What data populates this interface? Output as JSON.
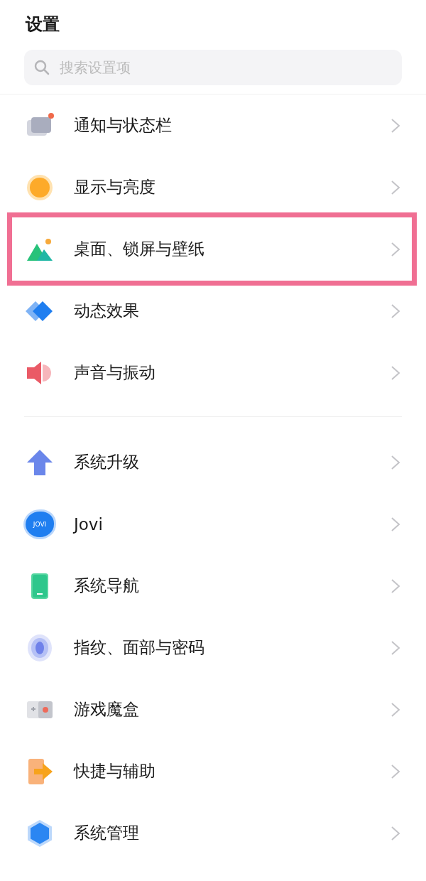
{
  "title": "设置",
  "search": {
    "placeholder": "搜索设置项"
  },
  "groups": [
    {
      "items": [
        {
          "kind": "notification",
          "label": "通知与状态栏",
          "highlighted": false
        },
        {
          "kind": "display",
          "label": "显示与亮度",
          "highlighted": false
        },
        {
          "kind": "wallpaper",
          "label": "桌面、锁屏与壁纸",
          "highlighted": true
        },
        {
          "kind": "motion",
          "label": "动态效果",
          "highlighted": false
        },
        {
          "kind": "sound",
          "label": "声音与振动",
          "highlighted": false
        }
      ]
    },
    {
      "items": [
        {
          "kind": "upgrade",
          "label": "系统升级",
          "highlighted": false
        },
        {
          "kind": "jovi",
          "label": "Jovi",
          "icon_text": "JOVI",
          "highlighted": false
        },
        {
          "kind": "navigation",
          "label": "系统导航",
          "highlighted": false
        },
        {
          "kind": "fingerprint",
          "label": "指纹、面部与密码",
          "highlighted": false
        },
        {
          "kind": "game",
          "label": "游戏魔盒",
          "highlighted": false
        },
        {
          "kind": "shortcut",
          "label": "快捷与辅助",
          "highlighted": false
        },
        {
          "kind": "manage",
          "label": "系统管理",
          "highlighted": false
        }
      ]
    }
  ]
}
